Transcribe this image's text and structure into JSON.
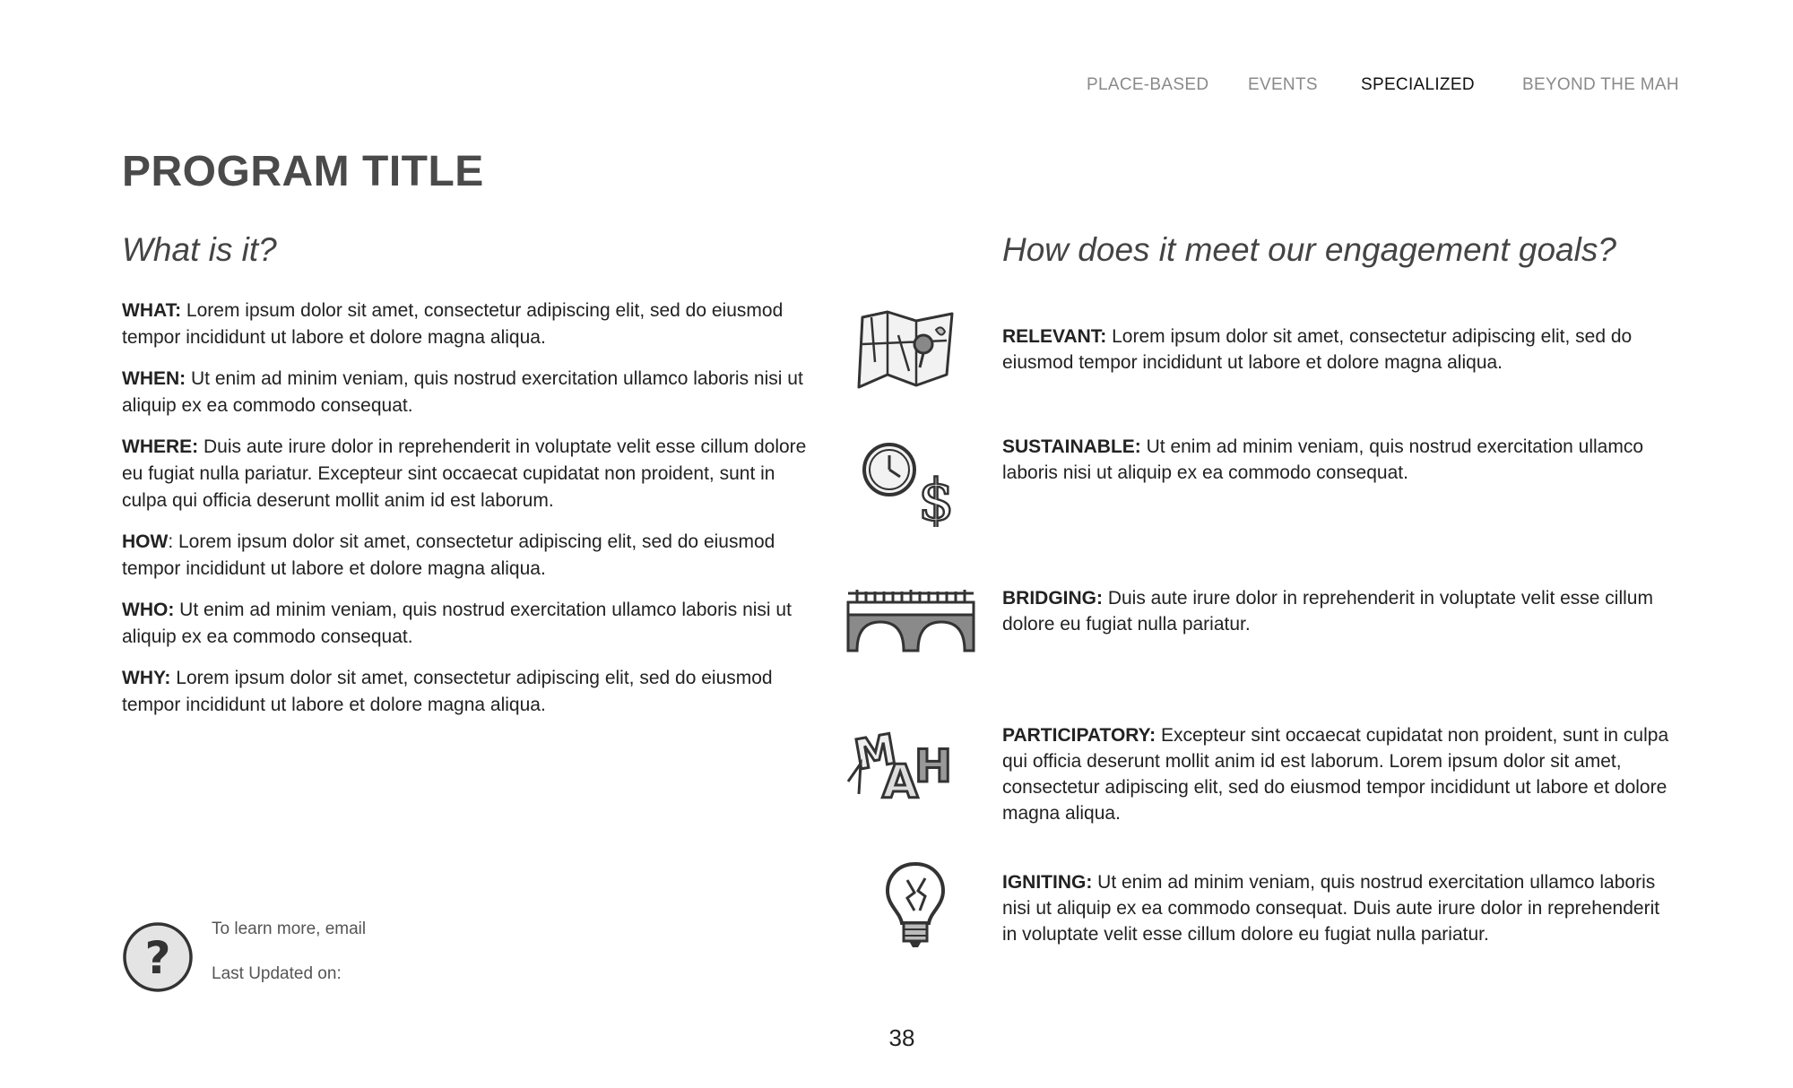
{
  "nav": {
    "items": [
      "PLACE-BASED",
      "EVENTS",
      "SPECIALIZED",
      "BEYOND THE MAH"
    ],
    "active": "SPECIALIZED"
  },
  "title": "PROGRAM TITLE",
  "left": {
    "heading": "What is it?",
    "items": [
      {
        "label": "WHAT:",
        "text": " Lorem ipsum dolor sit amet, consectetur adipiscing elit, sed do eiusmod tempor incididunt ut labore et dolore magna aliqua."
      },
      {
        "label": "WHEN:",
        "text": "  Ut enim ad minim veniam, quis nostrud exercitation ullamco laboris nisi ut aliquip ex ea commodo consequat."
      },
      {
        "label": "WHERE:",
        "text": " Duis aute irure dolor in reprehenderit in voluptate velit esse cillum dolore eu fugiat nulla pariatur. Excepteur sint occaecat cupidatat non proident, sunt in culpa qui officia deserunt mollit anim id est laborum."
      },
      {
        "label": "HOW",
        "text": ":  Lorem ipsum dolor sit amet, consectetur adipiscing elit, sed do eiusmod tempor incididunt ut labore et dolore magna aliqua."
      },
      {
        "label": "WHO:",
        "text": " Ut enim ad minim veniam, quis nostrud exercitation ullamco laboris nisi ut aliquip ex ea commodo consequat."
      },
      {
        "label": "WHY:",
        "text": " Lorem ipsum dolor sit amet, consectetur adipiscing elit, sed do eiusmod tempor incididunt ut labore et dolore magna aliqua."
      }
    ]
  },
  "right": {
    "heading": "How does it meet our engagement goals?",
    "goals": [
      {
        "label": "RELEVANT:",
        "text": "  Lorem ipsum dolor sit amet, consectetur adipiscing elit, sed do eiusmod tempor incididunt ut labore et dolore magna aliqua.",
        "icon": "map-icon"
      },
      {
        "label": "SUSTAINABLE:",
        "text": " Ut enim ad minim veniam, quis nostrud exercitation ullamco laboris nisi ut aliquip ex ea commodo consequat.",
        "icon": "clock-dollar-icon"
      },
      {
        "label": "BRIDGING:",
        "text": "  Duis aute irure dolor in reprehenderit in voluptate velit esse cillum dolore eu fugiat nulla pariatur.",
        "icon": "bridge-icon"
      },
      {
        "label": "PARTICIPATORY:",
        "text": " Excepteur sint occaecat cupidatat non proident, sunt in culpa qui officia deserunt mollit anim id est laborum. Lorem ipsum dolor sit amet, consectetur adipiscing elit, sed do eiusmod tempor incididunt ut labore et dolore magna aliqua.",
        "icon": "mah-letters-icon"
      },
      {
        "label": "IGNITING:",
        "text": "  Ut enim ad minim veniam, quis nostrud exercitation ullamco laboris nisi ut aliquip ex ea commodo consequat. Duis aute irure dolor in reprehenderit in voluptate velit esse cillum dolore eu fugiat nulla pariatur.",
        "icon": "lightbulb-icon"
      }
    ]
  },
  "footer": {
    "learn_more": "To learn more, email",
    "last_updated": "Last Updated on:",
    "help_glyph": "?",
    "page_number": "38"
  },
  "colors": {
    "text": "#222222",
    "title": "#4a4a4a",
    "nav_inactive": "#8a8a8a",
    "icon_gray": "#9a9a9a"
  }
}
